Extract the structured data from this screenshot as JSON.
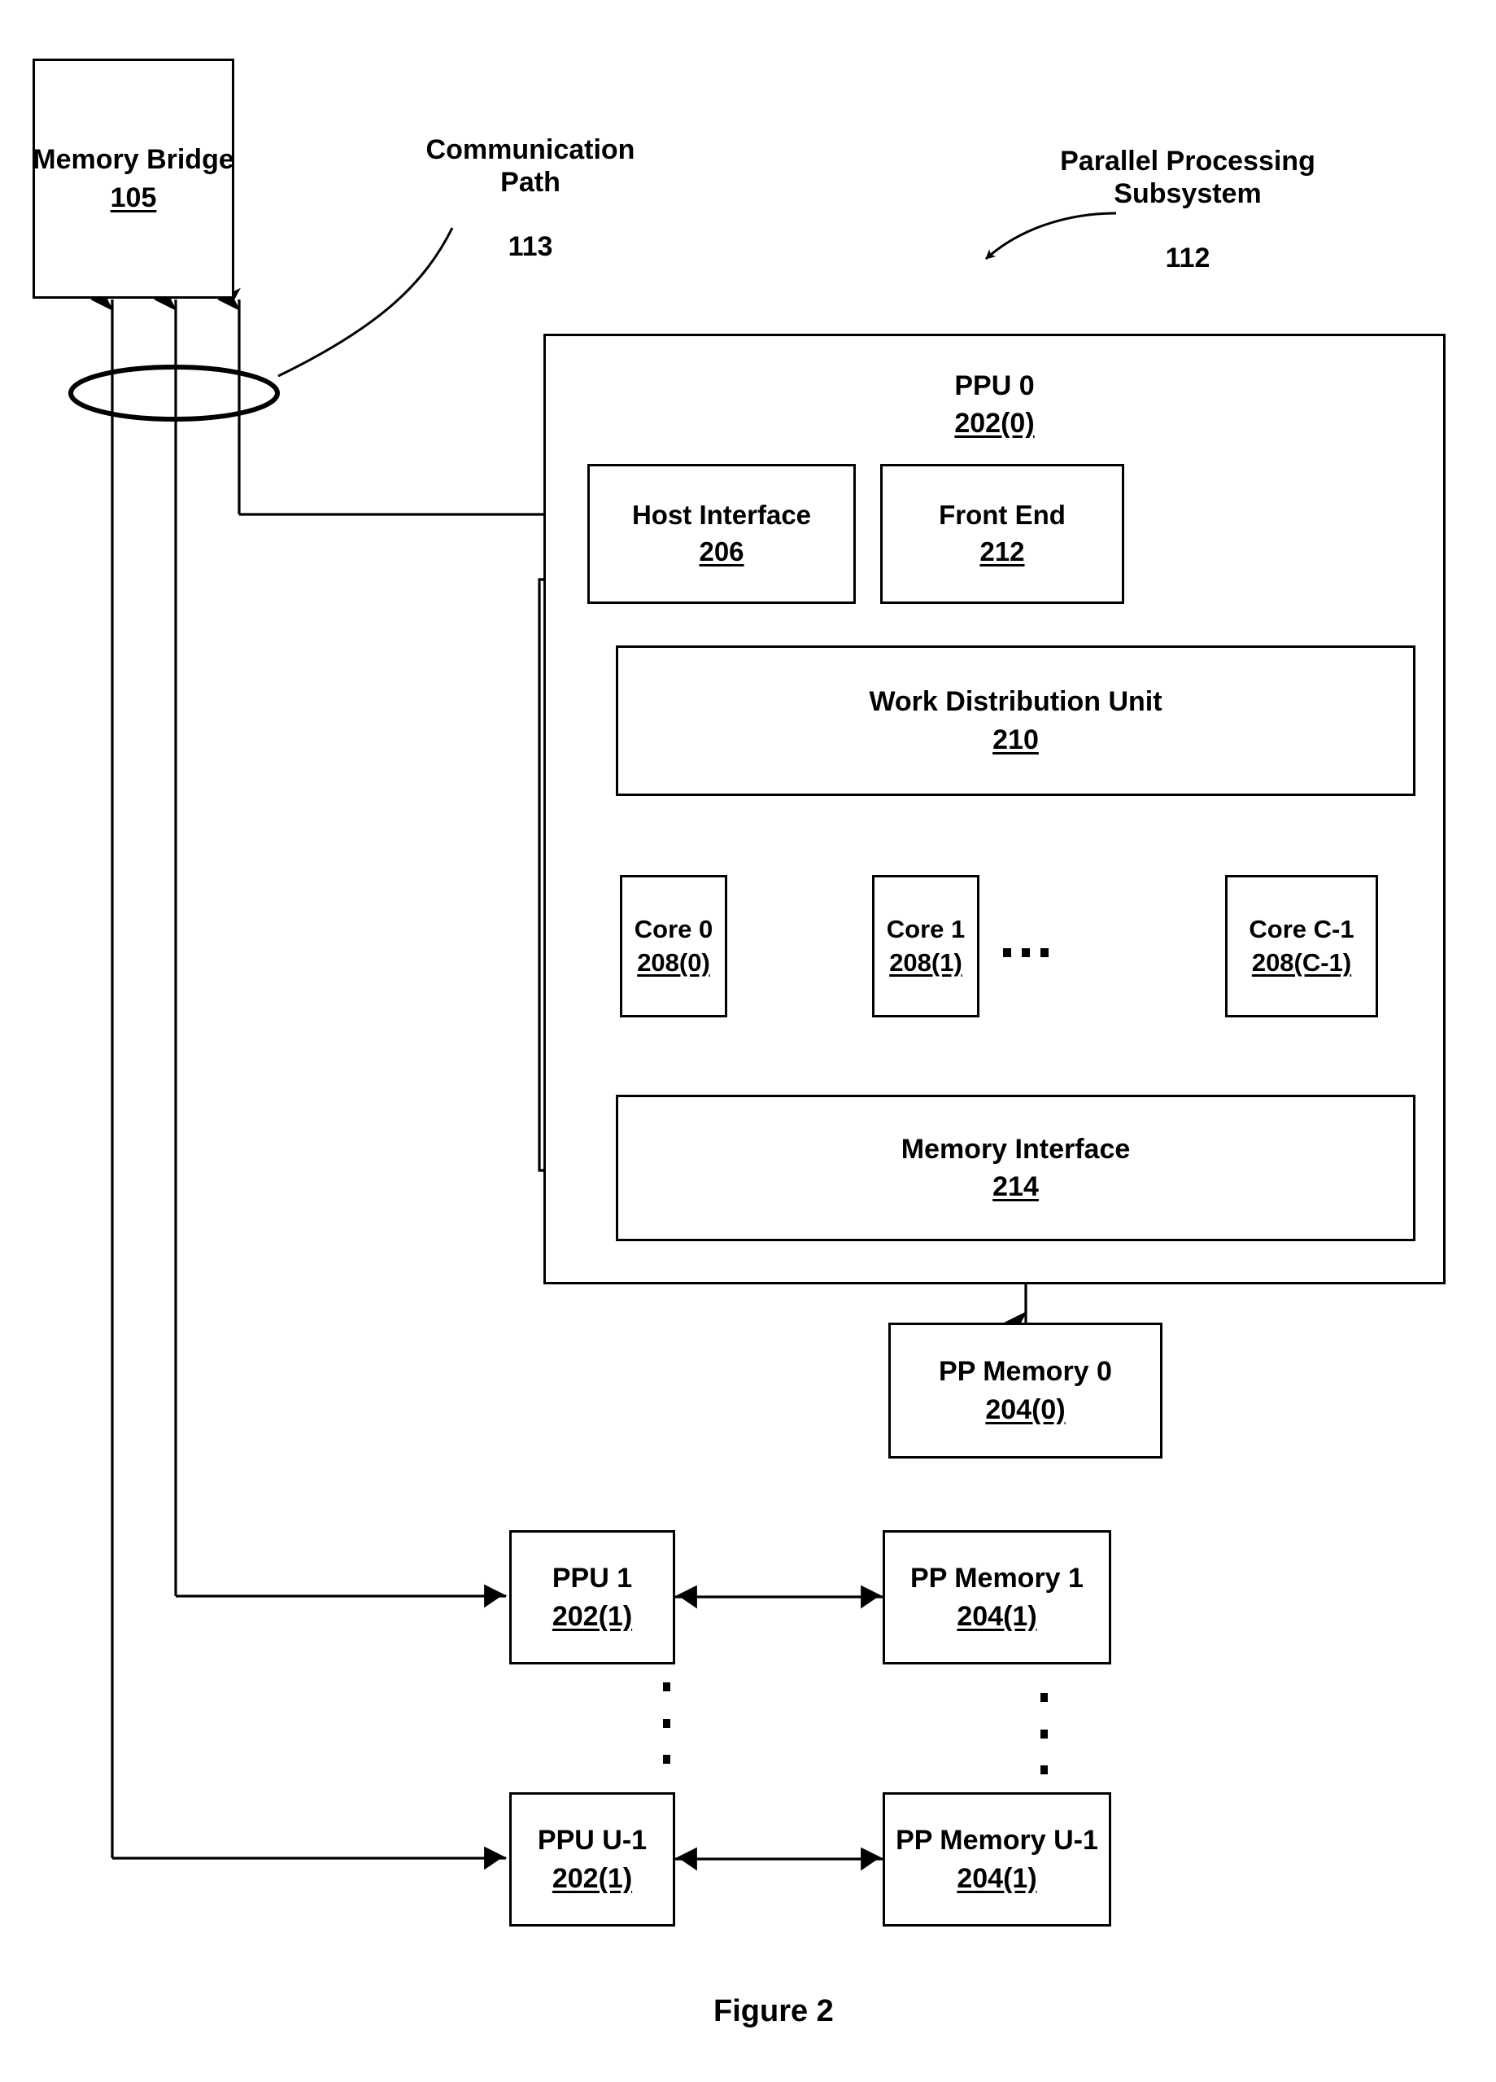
{
  "figure": {
    "caption": "Figure 2"
  },
  "labels": {
    "communication_path": {
      "name": "Communication\nPath",
      "number": "113"
    },
    "parallel_processing_subsystem": {
      "name": "Parallel Processing\nSubsystem",
      "number": "112"
    }
  },
  "blocks": {
    "memory_bridge": {
      "title": "Memory Bridge",
      "number": "105"
    },
    "ppu0": {
      "title": "PPU 0",
      "number": "202(0)"
    },
    "host_interface": {
      "title": "Host Interface",
      "number": "206"
    },
    "front_end": {
      "title": "Front End",
      "number": "212"
    },
    "work_distribution_unit": {
      "title": "Work Distribution Unit",
      "number": "210"
    },
    "core0": {
      "title": "Core 0",
      "number": "208(0)"
    },
    "core1": {
      "title": "Core 1",
      "number": "208(1)"
    },
    "core_c1": {
      "title": "Core C-1",
      "number": "208(C-1)"
    },
    "memory_interface": {
      "title": "Memory Interface",
      "number": "214"
    },
    "pp_memory0": {
      "title": "PP Memory 0",
      "number": "204(0)"
    },
    "ppu1": {
      "title": "PPU 1",
      "number": "202(1)"
    },
    "pp_memory1": {
      "title": "PP Memory 1",
      "number": "204(1)"
    },
    "ppu_u1": {
      "title": "PPU U-1",
      "number": "202(1)"
    },
    "pp_memory_u1": {
      "title": "PP Memory U-1",
      "number": "204(1)"
    }
  },
  "style": {
    "ink": "#000000",
    "paper": "#ffffff"
  }
}
